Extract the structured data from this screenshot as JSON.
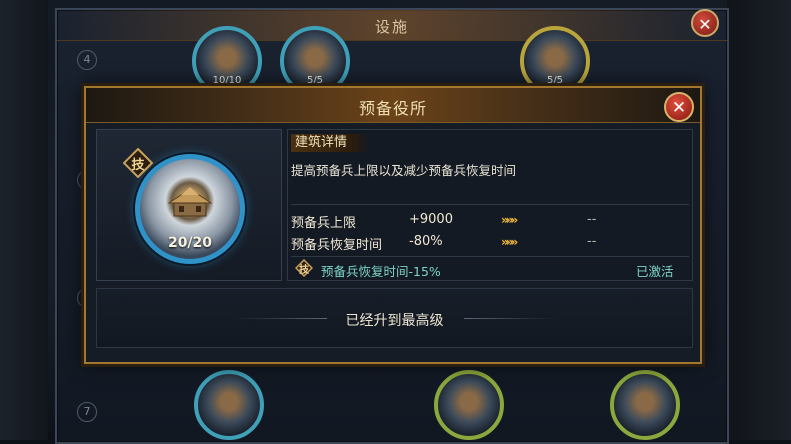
{
  "background": {
    "panel_title": "设施",
    "row_numbers": [
      "4",
      "5",
      "6",
      "7"
    ],
    "buildings": [
      {
        "count": "10/10"
      },
      {
        "count": "5/5"
      },
      {
        "count": "5/5"
      }
    ]
  },
  "modal": {
    "title": "预备役所",
    "building": {
      "level": "20/20",
      "tech_badge": "技"
    },
    "details": {
      "header": "建筑详情",
      "description": "提高预备兵上限以及减少预备兵恢复时间",
      "stats": [
        {
          "label": "预备兵上限",
          "value": "+9000",
          "arrows": "»»»",
          "next": "--"
        },
        {
          "label": "预备兵恢复时间",
          "value": "-80%",
          "arrows": "»»»",
          "next": "--"
        }
      ],
      "bonus": {
        "badge": "技",
        "text": "预备兵恢复时间-15%",
        "status": "已激活"
      }
    },
    "max_level_text": "已经升到最高级"
  },
  "colors": {
    "modal_border": "#a4772f",
    "ring_blue": "#2f93c9",
    "arrow_gold": "#f2b93a",
    "bonus_teal": "#7ed3c8",
    "close_red": "#c9362a"
  },
  "icons": [
    "close-icon",
    "tech-badge-icon",
    "double-arrow-icon",
    "building-icon"
  ]
}
